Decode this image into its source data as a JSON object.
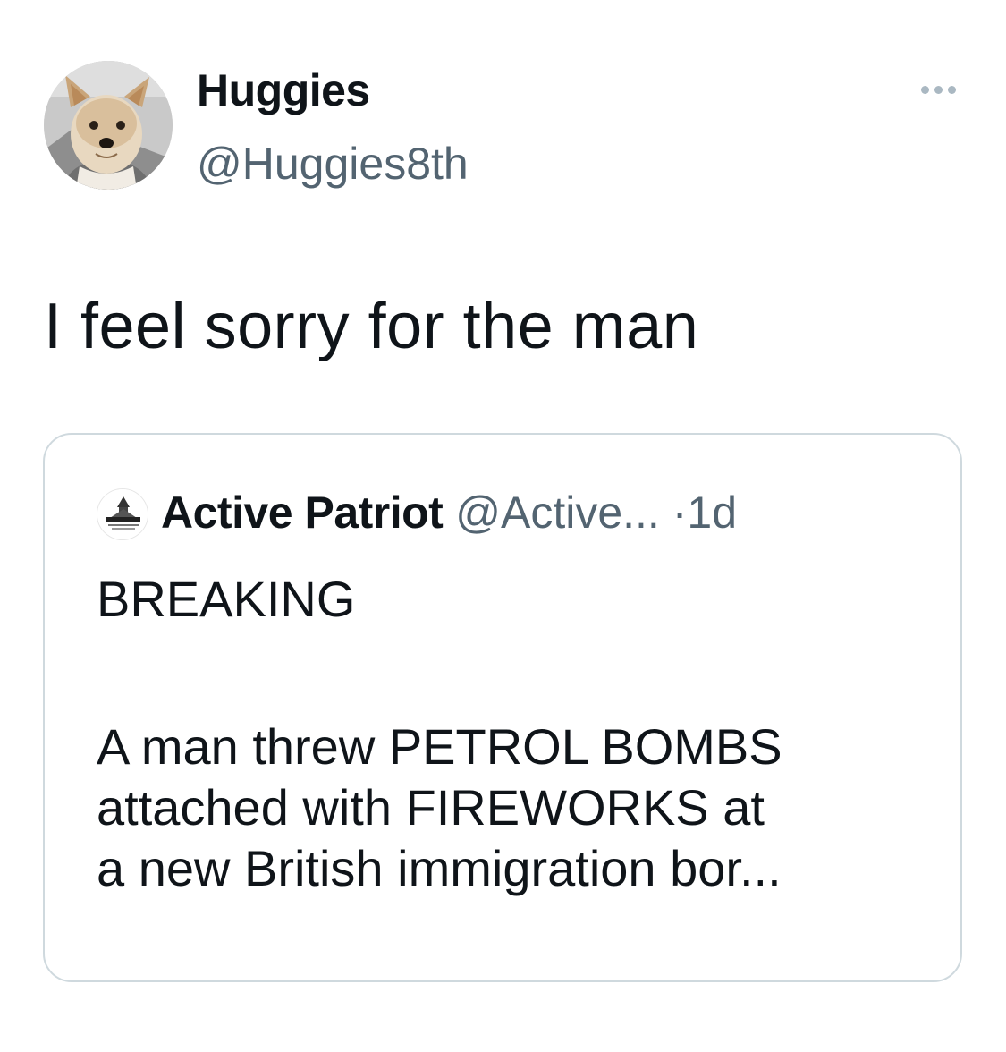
{
  "author": {
    "display_name": "Huggies",
    "handle": "@Huggies8th",
    "avatar_icon": "dog-avatar"
  },
  "menu_icon": "more-options-icon",
  "tweet_text": "I feel sorry for the man",
  "quoted_tweet": {
    "display_name": "Active Patriot",
    "handle": "@Active...",
    "separator": "·",
    "time": "1d",
    "avatar_icon": "active-patriot-logo",
    "avatar_logo_text": "ACTIVE PATRIOT",
    "headline": "BREAKING",
    "body_lines": [
      "A man threw PETROL BOMBS",
      "attached with FIREWORKS at",
      "a new British immigration bor..."
    ]
  },
  "colors": {
    "text_primary": "#0f1419",
    "text_secondary": "#536471",
    "border": "#cfd9de",
    "dots": "#aab8c2"
  }
}
